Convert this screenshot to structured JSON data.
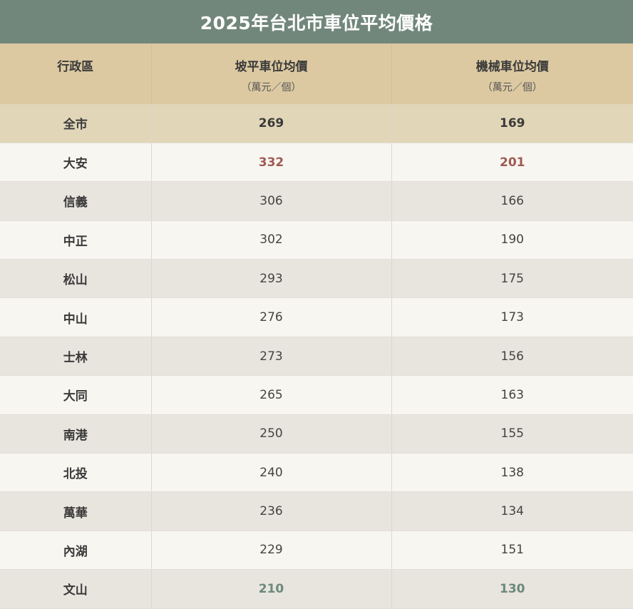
{
  "chart_data": {
    "type": "table",
    "title": "2025年台北市車位平均價格",
    "columns": [
      {
        "label": "行政區",
        "unit": ""
      },
      {
        "label": "坡平車位均價",
        "unit": "（萬元／個）"
      },
      {
        "label": "機械車位均價",
        "unit": "（萬元／個）"
      }
    ],
    "rows": [
      {
        "district": "全市",
        "ramp": 269,
        "mechanical": 169
      },
      {
        "district": "大安",
        "ramp": 332,
        "mechanical": 201
      },
      {
        "district": "信義",
        "ramp": 306,
        "mechanical": 166
      },
      {
        "district": "中正",
        "ramp": 302,
        "mechanical": 190
      },
      {
        "district": "松山",
        "ramp": 293,
        "mechanical": 175
      },
      {
        "district": "中山",
        "ramp": 276,
        "mechanical": 173
      },
      {
        "district": "士林",
        "ramp": 273,
        "mechanical": 156
      },
      {
        "district": "大同",
        "ramp": 265,
        "mechanical": 163
      },
      {
        "district": "南港",
        "ramp": 250,
        "mechanical": 155
      },
      {
        "district": "北投",
        "ramp": 240,
        "mechanical": 138
      },
      {
        "district": "萬華",
        "ramp": 236,
        "mechanical": 134
      },
      {
        "district": "內湖",
        "ramp": 229,
        "mechanical": 151
      },
      {
        "district": "文山",
        "ramp": 210,
        "mechanical": 130
      }
    ],
    "colors": {
      "title_bg": "#72877c",
      "header_bg": "#dcc9a1",
      "total_row_bg": "#e2d6b9",
      "highest_value": "#a05a55",
      "lowest_value": "#6b8a7a"
    }
  }
}
